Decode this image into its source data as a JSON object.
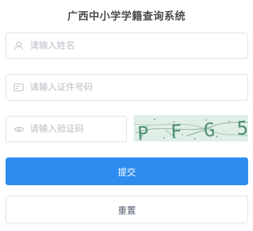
{
  "title": "广西中小学学籍查询系统",
  "form": {
    "name": {
      "placeholder": "请输入姓名",
      "icon": "user-icon"
    },
    "id_number": {
      "placeholder": "请输入证件号码",
      "icon": "id-card-icon"
    },
    "captcha": {
      "placeholder": "请输入验证码",
      "icon": "eye-icon",
      "image_text": "PFG5"
    }
  },
  "buttons": {
    "submit_label": "提交",
    "reset_label": "重置"
  },
  "colors": {
    "primary": "#2d8cf0",
    "border": "#dcdfe6",
    "placeholder": "#b8bcc4",
    "captcha_bg": "#dfeee6",
    "captcha_text": "#4f8f72"
  }
}
